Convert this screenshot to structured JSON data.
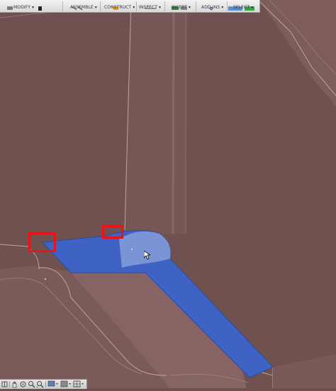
{
  "toolbar": {
    "groups": [
      {
        "label": "MODIFY ▾"
      },
      {
        "label": "ASSEMBLE ▾"
      },
      {
        "label": "CONSTRUCT ▾"
      },
      {
        "label": "INSPECT ▾"
      },
      {
        "label": "INSERT ▾"
      },
      {
        "label": "ADD-INS ▾"
      },
      {
        "label": "SELECT ▾"
      }
    ]
  },
  "navbar": {
    "icons": [
      "grid-snap-icon",
      "pan-hand-icon",
      "orbit-icon",
      "zoom-icon",
      "zoom-window-icon",
      "display-settings-icon",
      "visual-style-icon",
      "grid-settings-icon"
    ]
  },
  "colors": {
    "body": "#6f5150",
    "selection": "#3f63c4",
    "selection_highlight": "#7b94d6",
    "marker": "#e8141a",
    "edge": "#b9a5a3"
  }
}
